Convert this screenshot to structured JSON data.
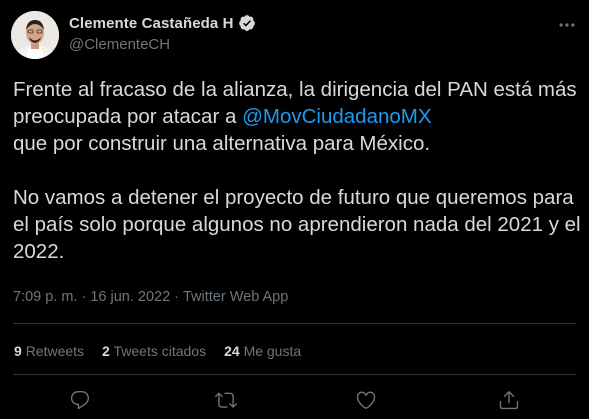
{
  "author": {
    "display_name": "Clemente Castañeda H",
    "handle": "@ClementeCH"
  },
  "tweet": {
    "para1_before": "Frente al fracaso de la alianza, la dirigencia del PAN está más preocupada por atacar a ",
    "mention": "@MovCiudadanoMX",
    "para1_after": "que por construir una alternativa para México.",
    "para2": "No vamos a detener el proyecto de futuro que queremos para el país solo porque algunos no aprendieron nada del 2021 y el 2022."
  },
  "meta": {
    "time": "7:09 p. m.",
    "separator": "·",
    "date": "16 jun. 2022",
    "source": "Twitter Web App"
  },
  "stats": {
    "retweets_count": "9",
    "retweets_label": "Retweets",
    "quotes_count": "2",
    "quotes_label": "Tweets citados",
    "likes_count": "24",
    "likes_label": "Me gusta"
  },
  "colors": {
    "background": "#000000",
    "text": "#d9d9d9",
    "secondary": "#6e767d",
    "accent": "#1d9bf0",
    "divider": "#2f3336"
  },
  "icons": {
    "more": "more-dots-icon",
    "verified": "verified-badge-icon",
    "reply": "reply-icon",
    "retweet": "retweet-icon",
    "like": "heart-icon",
    "share": "share-icon"
  }
}
